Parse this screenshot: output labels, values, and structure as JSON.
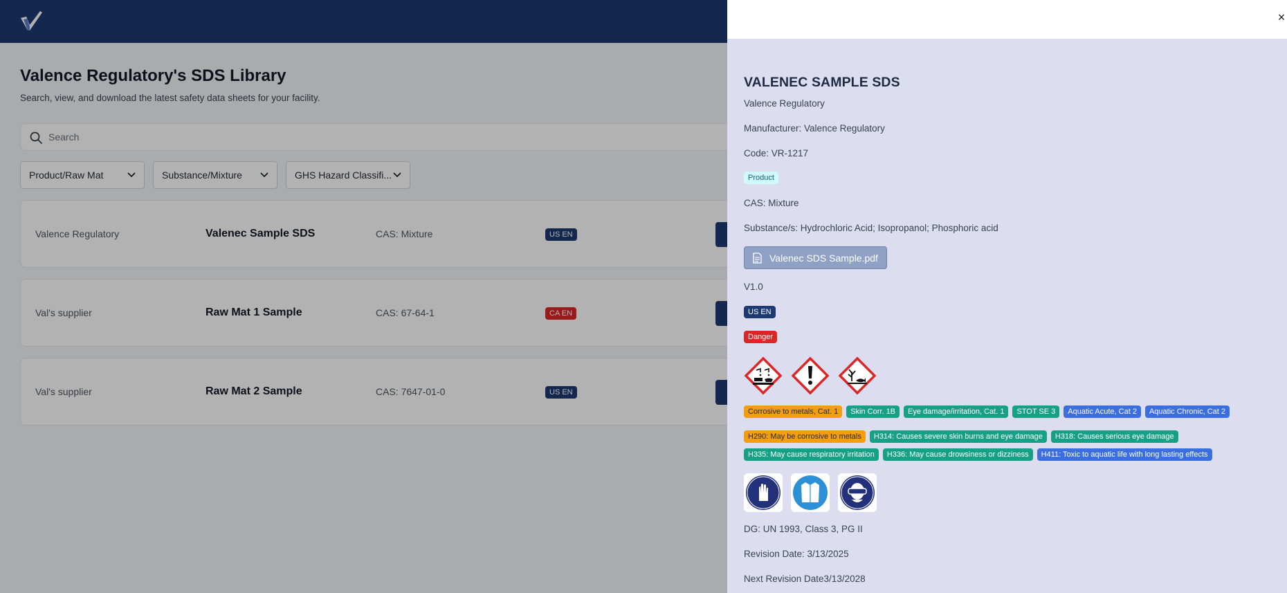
{
  "header": {
    "logo_icon": "checkmark-logo-icon"
  },
  "page": {
    "title": "Valence Regulatory's SDS Library",
    "subtitle": "Search, view, and download the latest safety data sheets for your facility.",
    "search_placeholder": "Search",
    "filters": [
      "Product/Raw Mat",
      "Substance/Mixture",
      "GHS Hazard Classifi..."
    ]
  },
  "rows": [
    {
      "supplier": "Valence Regulatory",
      "name": "Valenec Sample SDS",
      "cas": "CAS: Mixture",
      "lang": "US EN",
      "lang_color": "#1e3a72"
    },
    {
      "supplier": "Val's supplier",
      "name": "Raw Mat 1 Sample",
      "cas": "CAS: 67-64-1",
      "lang": "CA EN",
      "lang_color": "#dc2626"
    },
    {
      "supplier": "Val's supplier",
      "name": "Raw Mat 2 Sample",
      "cas": "CAS: 7647-01-0",
      "lang": "US EN",
      "lang_color": "#1e3a72"
    }
  ],
  "drawer": {
    "close_label": "×",
    "title": "VALENEC SAMPLE SDS",
    "company": "Valence Regulatory",
    "manufacturer": "Manufacturer: Valence Regulatory",
    "code": "Code: VR-1217",
    "type_badge": "Product",
    "cas": "CAS: Mixture",
    "substances": "Substance/s: Hydrochloric Acid; Isopropanol; Phosphoric acid",
    "file_name": "Valenec SDS Sample.pdf",
    "version": "V1.0",
    "lang": "US EN",
    "signal_word": "Danger",
    "pictograms": [
      "corrosion-pictogram-icon",
      "exclamation-mark-pictogram-icon",
      "environment-pictogram-icon"
    ],
    "classifications": [
      {
        "label": "Corrosive to metals, Cat. 1",
        "color": "amber"
      },
      {
        "label": "Skin Corr. 1B",
        "color": "green"
      },
      {
        "label": "Eye damage/irritation, Cat. 1",
        "color": "green"
      },
      {
        "label": "STOT SE 3",
        "color": "green"
      },
      {
        "label": "Aquatic Acute, Cat 2",
        "color": "blue"
      },
      {
        "label": "Aquatic Chronic, Cat 2",
        "color": "blue"
      }
    ],
    "hazard_statements_row1": [
      {
        "label": "H290: May be corrosive to metals",
        "color": "amber"
      },
      {
        "label": "H314: Causes severe skin burns and eye damage",
        "color": "green"
      },
      {
        "label": "H318: Causes serious eye damage",
        "color": "green"
      }
    ],
    "hazard_statements_row2": [
      {
        "label": "H335: May cause respiratory irritation",
        "color": "green"
      },
      {
        "label": "H336: May cause drowsiness or dizziness",
        "color": "green"
      },
      {
        "label": "H411: Toxic to aquatic life with long lasting effects",
        "color": "blue"
      }
    ],
    "ppe": [
      "gloves-ppe-icon",
      "lab-coat-ppe-icon",
      "safety-goggles-ppe-icon"
    ],
    "dg": "DG: UN 1993, Class 3, PG II",
    "revision_date": "Revision Date: 3/13/2025",
    "next_revision_date": "Next Revision Date3/13/2028"
  }
}
